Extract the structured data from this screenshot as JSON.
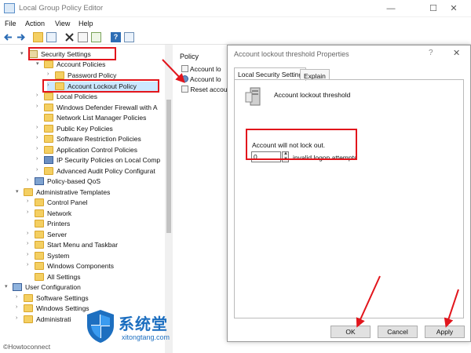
{
  "window": {
    "title": "Local Group Policy Editor",
    "min_glyph": "—",
    "max_glyph": "☐",
    "close_glyph": "✕"
  },
  "menu": [
    "File",
    "Action",
    "View",
    "Help"
  ],
  "toolbar_icons": [
    "back-icon",
    "forward-icon",
    "up-folder-icon",
    "show-hide-tree-icon",
    "delete-icon",
    "properties-icon",
    "export-list-icon",
    "help-icon",
    "console-icon"
  ],
  "tree": {
    "items": [
      {
        "label": "Security Settings",
        "expanded": true
      },
      {
        "label": "Account Policies",
        "expanded": true
      },
      {
        "label": "Password Policy"
      },
      {
        "label": "Account Lockout Policy",
        "selected": true
      },
      {
        "label": "Local Policies"
      },
      {
        "label": "Windows Defender Firewall with A"
      },
      {
        "label": "Network List Manager Policies"
      },
      {
        "label": "Public Key Policies"
      },
      {
        "label": "Software Restriction Policies"
      },
      {
        "label": "Application Control Policies"
      },
      {
        "label": "IP Security Policies on Local Comp"
      },
      {
        "label": "Advanced Audit Policy Configurat"
      },
      {
        "label": "Policy-based QoS"
      },
      {
        "label": "Administrative Templates",
        "expanded": true
      },
      {
        "label": "Control Panel"
      },
      {
        "label": "Network"
      },
      {
        "label": "Printers"
      },
      {
        "label": "Server"
      },
      {
        "label": "Start Menu and Taskbar"
      },
      {
        "label": "System"
      },
      {
        "label": "Windows Components"
      },
      {
        "label": "All Settings"
      },
      {
        "label": "User Configuration",
        "expanded": true
      },
      {
        "label": "Software Settings"
      },
      {
        "label": "Windows Settings"
      },
      {
        "label": "Administrati"
      }
    ]
  },
  "list": {
    "header": "Policy",
    "rows": [
      "Account lo",
      "Account lo",
      "Reset accou"
    ]
  },
  "dialog": {
    "title": "Account lockout threshold Properties",
    "help_glyph": "?",
    "close_glyph": "✕",
    "tabs": [
      "Local Security Setting",
      "Explain"
    ],
    "setting_name": "Account lockout threshold",
    "status_text": "Account will not lock out.",
    "value": "0",
    "unit_label": "invalid logon attempts",
    "buttons": {
      "ok": "OK",
      "cancel": "Cancel",
      "apply": "Apply"
    }
  },
  "watermark": {
    "brand_cn": "系统堂",
    "site": "xitongtang.com",
    "credit": "©Howtoconnect"
  },
  "colors": {
    "highlight_red": "#e2151c",
    "selection": "#cce8ff",
    "folder": "#f4cf62",
    "brand_blue": "#1d6fc0"
  }
}
